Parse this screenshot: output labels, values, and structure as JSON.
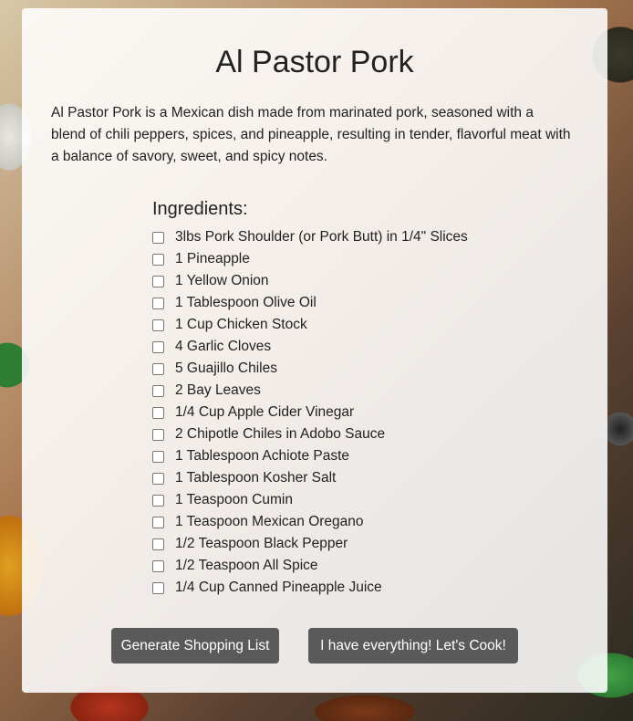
{
  "recipe": {
    "title": "Al Pastor Pork",
    "description": "Al Pastor Pork is a Mexican dish made from marinated pork, seasoned with a blend of chili peppers, spices, and pineapple, resulting in tender, flavorful meat with a balance of savory, sweet, and spicy notes.",
    "ingredients_heading": "Ingredients:",
    "ingredients": [
      {
        "label": "3lbs Pork Shoulder (or Pork Butt) in 1/4\" Slices",
        "checked": false
      },
      {
        "label": "1 Pineapple",
        "checked": false
      },
      {
        "label": "1 Yellow Onion",
        "checked": false
      },
      {
        "label": "1 Tablespoon Olive Oil",
        "checked": false
      },
      {
        "label": "1 Cup Chicken Stock",
        "checked": false
      },
      {
        "label": "4 Garlic Cloves",
        "checked": false
      },
      {
        "label": "5 Guajillo Chiles",
        "checked": false
      },
      {
        "label": "2 Bay Leaves",
        "checked": false
      },
      {
        "label": "1/4 Cup Apple Cider Vinegar",
        "checked": false
      },
      {
        "label": "2 Chipotle Chiles in Adobo Sauce",
        "checked": false
      },
      {
        "label": "1 Tablespoon Achiote Paste",
        "checked": false
      },
      {
        "label": "1 Tablespoon Kosher Salt",
        "checked": false
      },
      {
        "label": "1 Teaspoon Cumin",
        "checked": false
      },
      {
        "label": "1 Teaspoon Mexican Oregano",
        "checked": false
      },
      {
        "label": "1/2 Teaspoon Black Pepper",
        "checked": false
      },
      {
        "label": "1/2 Teaspoon All Spice",
        "checked": false
      },
      {
        "label": "1/4 Cup Canned Pineapple Juice",
        "checked": false
      }
    ]
  },
  "actions": {
    "shopping_list_label": "Generate Shopping List",
    "cook_label": "I have everything! Let's Cook!"
  }
}
